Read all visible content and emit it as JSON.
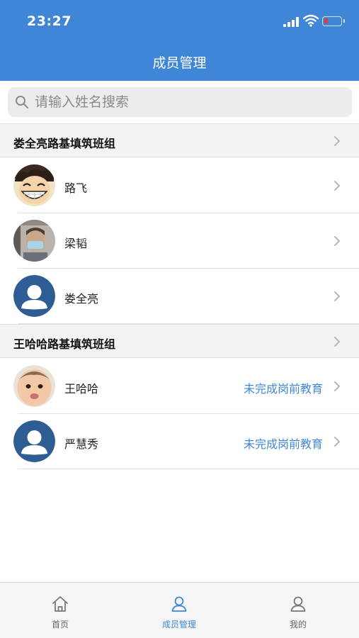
{
  "status_bar": {
    "time": "23:27"
  },
  "nav": {
    "title": "成员管理"
  },
  "search": {
    "placeholder": "请输入姓名搜索"
  },
  "groups": [
    {
      "title": "娄全亮路基填筑班组",
      "members": [
        {
          "name": "路飞",
          "status": "",
          "avatar": "photo-avatar-cartoon"
        },
        {
          "name": "梁韬",
          "status": "",
          "avatar": "photo-avatar-person"
        },
        {
          "name": "娄全亮",
          "status": "",
          "avatar": "default-user-avatar"
        }
      ]
    },
    {
      "title": "王哈哈路基填筑班组",
      "members": [
        {
          "name": "王哈哈",
          "status": "未完成岗前教育",
          "avatar": "photo-avatar-baby"
        },
        {
          "name": "严慧秀",
          "status": "未完成岗前教育",
          "avatar": "default-user-avatar"
        }
      ]
    }
  ],
  "tabbar": {
    "items": [
      {
        "label": "首页",
        "icon": "home-icon",
        "active": false
      },
      {
        "label": "成员管理",
        "icon": "user-icon",
        "active": true
      },
      {
        "label": "我的",
        "icon": "user-icon",
        "active": false
      }
    ]
  },
  "colors": {
    "primary": "#3f87d6",
    "status_text": "#3f87d6",
    "battery_low": "#e53935"
  }
}
